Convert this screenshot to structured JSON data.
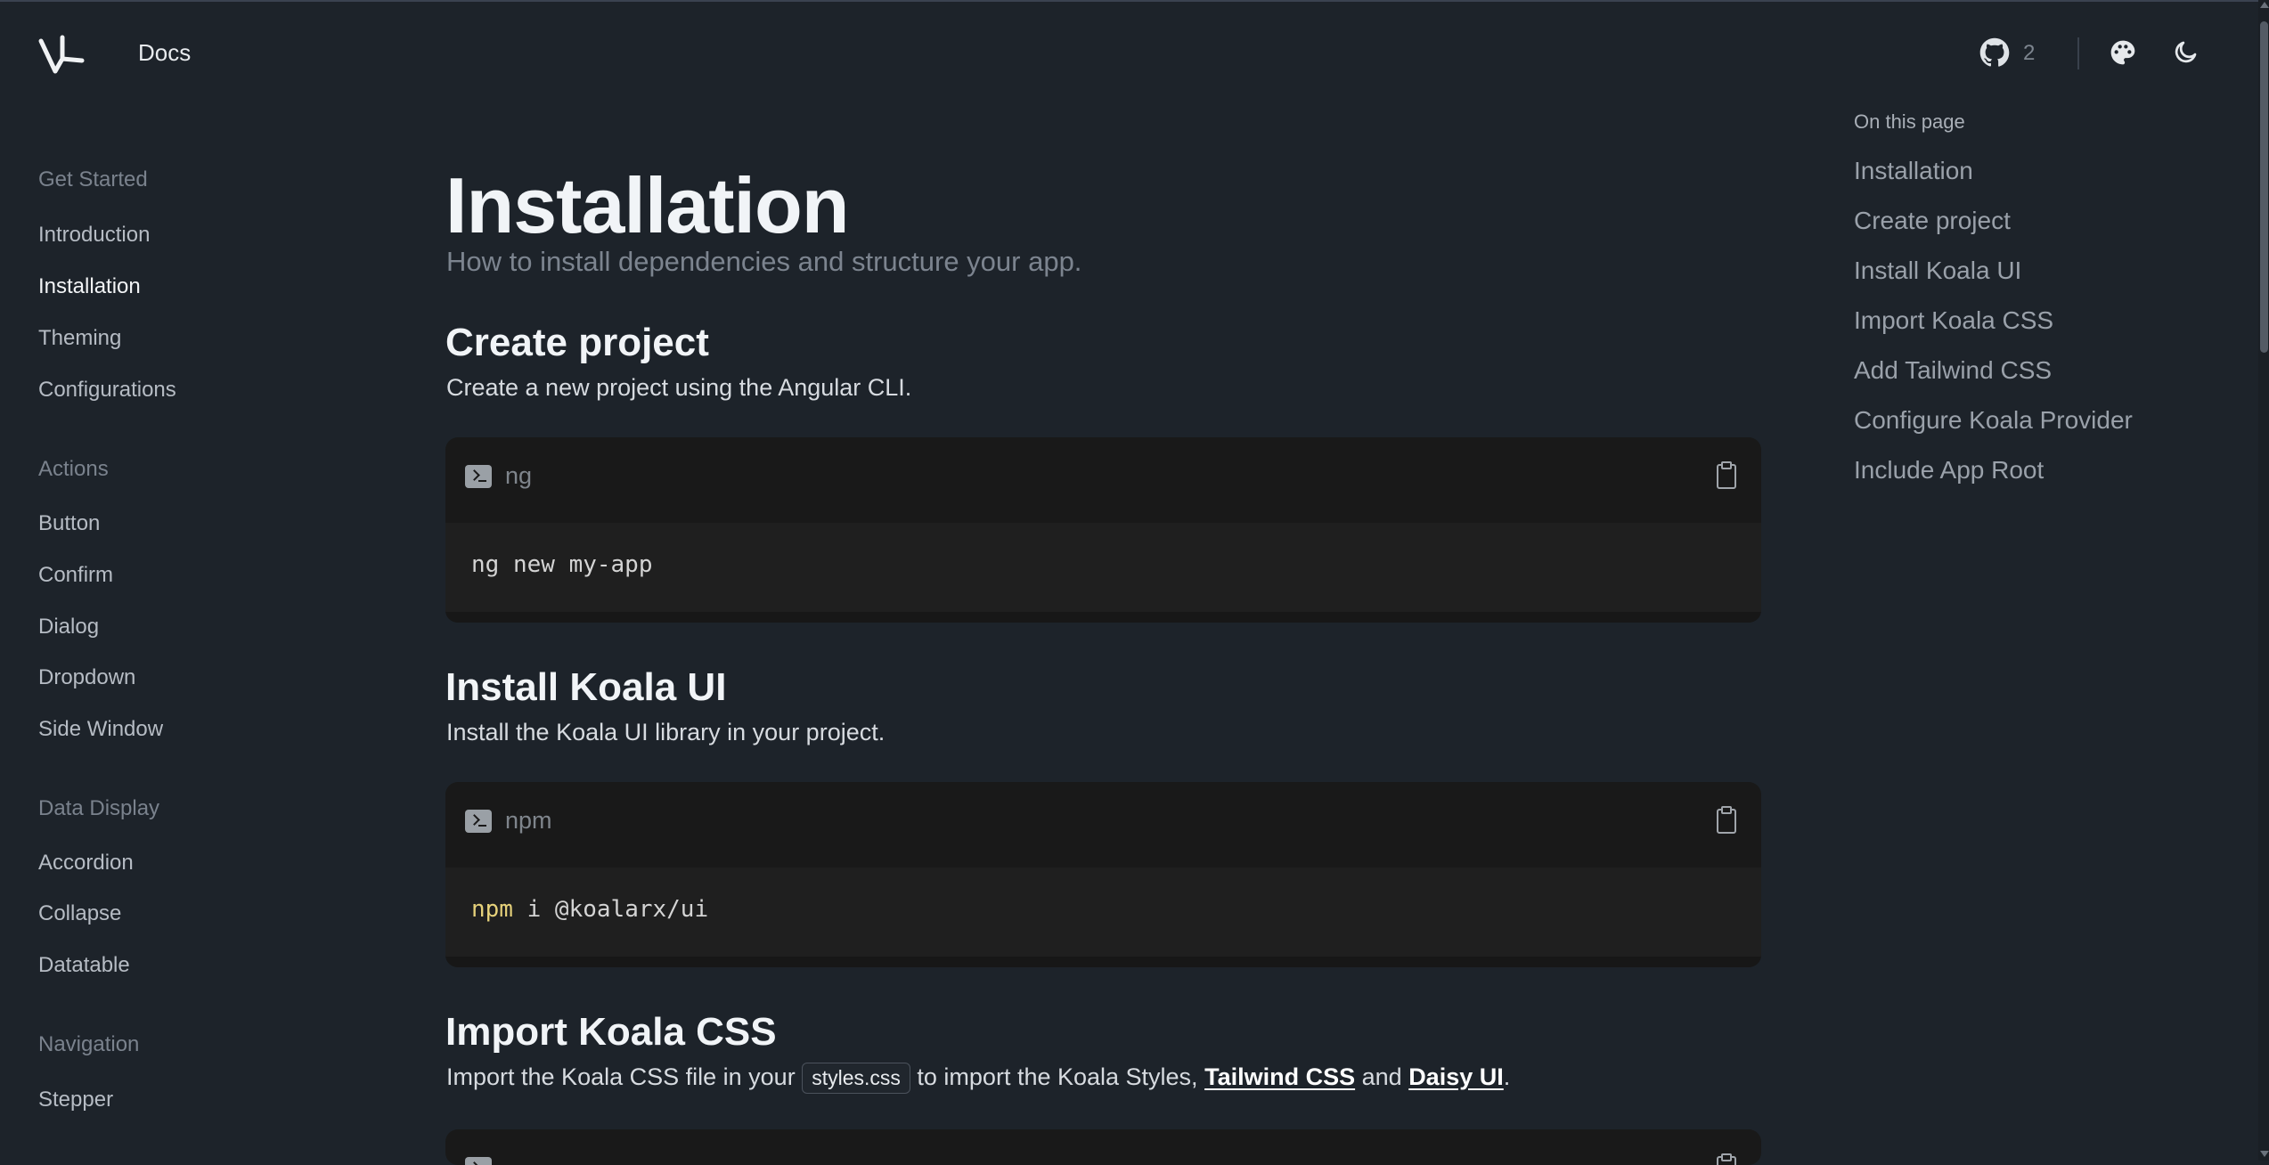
{
  "header": {
    "brand": "Docs",
    "github_count": "2"
  },
  "sidebar": {
    "groups": [
      {
        "title": "Get Started",
        "items": [
          "Introduction",
          "Installation",
          "Theming",
          "Configurations"
        ]
      },
      {
        "title": "Actions",
        "items": [
          "Button",
          "Confirm",
          "Dialog",
          "Dropdown",
          "Side Window"
        ]
      },
      {
        "title": "Data Display",
        "items": [
          "Accordion",
          "Collapse",
          "Datatable"
        ]
      },
      {
        "title": "Navigation",
        "items": [
          "Stepper"
        ]
      }
    ],
    "active": "Installation"
  },
  "main": {
    "title": "Installation",
    "subtitle": "How to install dependencies and structure your app.",
    "sections": [
      {
        "title": "Create project",
        "desc": "Create a new project using the Angular CLI.",
        "code_lang": "ng",
        "code": "ng new my-app"
      },
      {
        "title": "Install Koala UI",
        "desc": "Install the Koala UI library in your project.",
        "code_lang": "npm",
        "code_kw": "npm",
        "code_rest": " i @koalarx/ui"
      },
      {
        "title": "Import Koala CSS",
        "desc_pre": "Import the Koala CSS file in your",
        "desc_code": "styles.css",
        "desc_mid": "to import the Koala Styles,",
        "desc_link1": "Tailwind CSS",
        "desc_and": "and",
        "desc_link2": "Daisy UI",
        "desc_end": "."
      }
    ]
  },
  "toc": {
    "heading": "On this page",
    "items": [
      "Installation",
      "Create project",
      "Install Koala UI",
      "Import Koala CSS",
      "Add Tailwind CSS",
      "Configure Koala Provider",
      "Include App Root"
    ]
  },
  "icons": {
    "logo": "koala-logo-icon",
    "github": "github-icon",
    "theme": "palette-icon",
    "mode": "moon-icon",
    "terminal": "terminal-icon",
    "copy": "clipboard-icon"
  }
}
